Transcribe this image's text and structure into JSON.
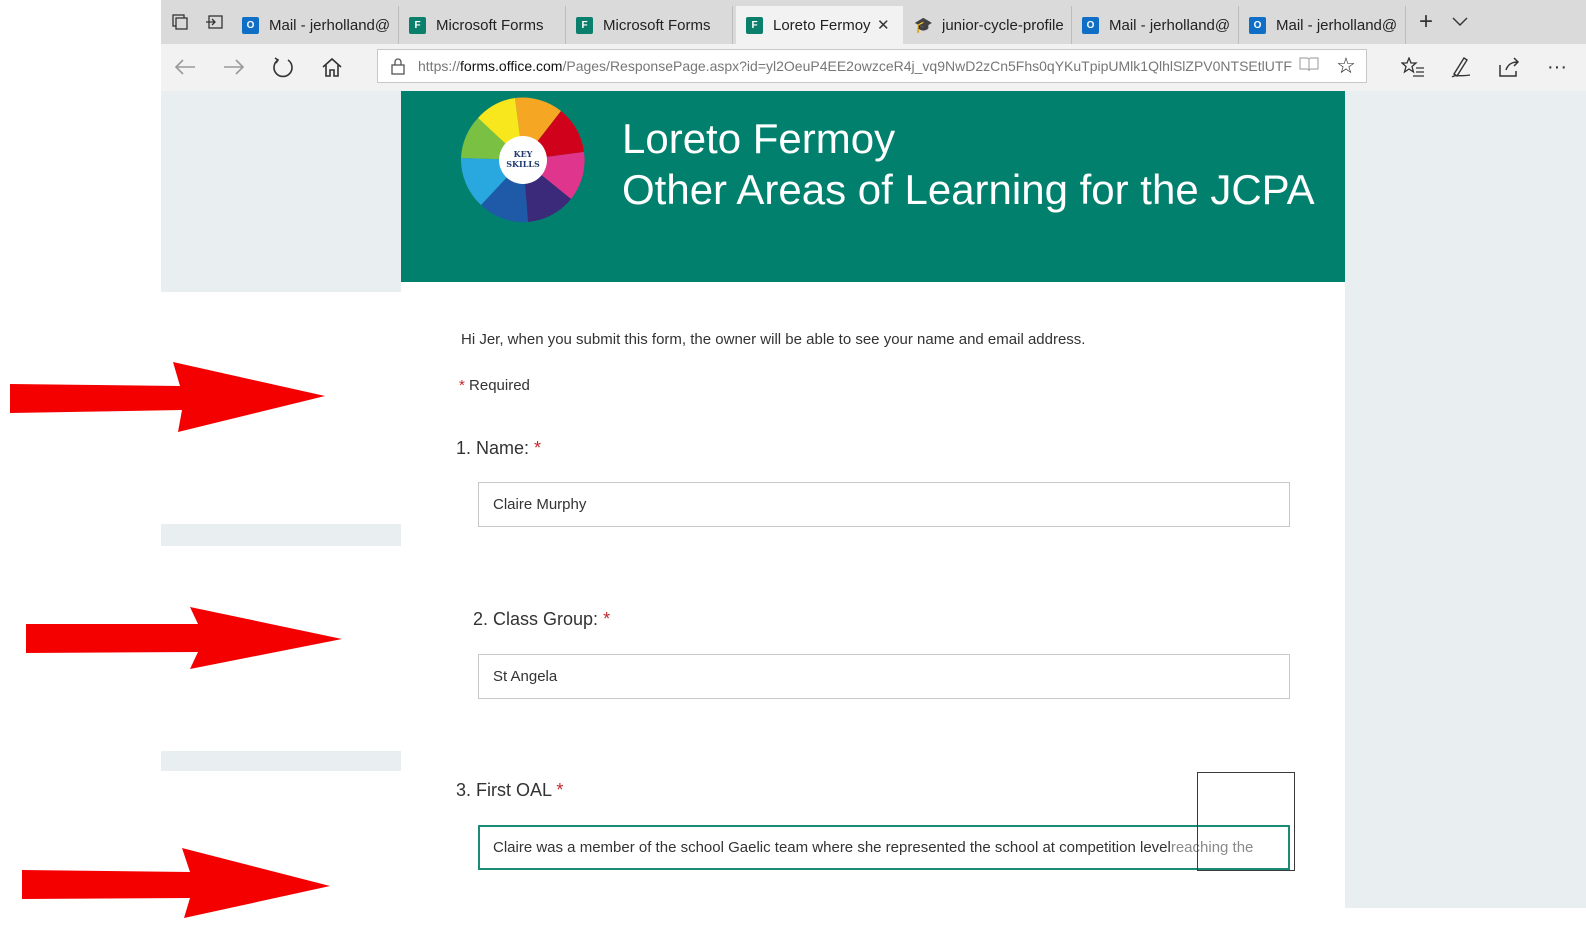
{
  "browser": {
    "tabs": [
      {
        "label": "Mail - jerholland@",
        "icon": "outlook-icon",
        "active": false
      },
      {
        "label": "Microsoft Forms",
        "icon": "forms-icon",
        "active": false
      },
      {
        "label": "Microsoft Forms",
        "icon": "forms-icon",
        "active": false
      },
      {
        "label": "Loreto Fermoy",
        "icon": "forms-icon",
        "active": true
      },
      {
        "label": "junior-cycle-profile",
        "icon": "graduation-cap-icon",
        "active": false
      },
      {
        "label": "Mail - jerholland@",
        "icon": "outlook-icon",
        "active": false
      },
      {
        "label": "Mail - jerholland@",
        "icon": "outlook-icon",
        "active": false
      }
    ],
    "url_prefix": "https://",
    "url_domain": "forms.office.com",
    "url_path": "/Pages/ResponsePage.aspx?id=yl2OeuP4EE2owzceR4j_vq9NwD2zCn5Fhs0qYKuTpipUMlk1QlhlSlZPV0NTSEtlUTFF"
  },
  "form": {
    "school": "Loreto Fermoy",
    "title": "Other Areas of Learning for the JCPA",
    "logo_text": [
      "KEY",
      "SKILLS"
    ],
    "intro": "Hi Jer, when you submit this form, the owner will be able to see your name and email address.",
    "required_star": "*",
    "required_label": "Required",
    "questions": [
      {
        "label": "1. Name:",
        "star": "*",
        "value": "Claire Murphy"
      },
      {
        "label": "2. Class Group:",
        "star": "*",
        "value": "St Angela"
      },
      {
        "label": "3. First OAL",
        "star": "*",
        "value": "Claire was a member of the school Gaelic team where she represented the school at competition level",
        "value_overflow": " reaching the"
      }
    ]
  },
  "colors": {
    "header_bg": "#02806e",
    "required_star": "#c4262e",
    "arrow": "#f40000",
    "side_panel": "#e9eef0"
  }
}
